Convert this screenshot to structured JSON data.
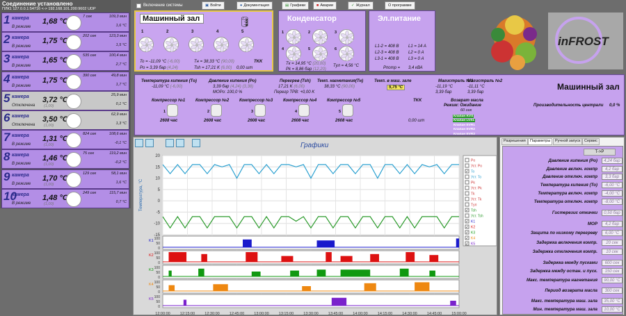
{
  "status": {
    "line1": "Соединение установлено",
    "line2": "ПЛК1 127.0.0.1:54716 <-> 192.168.101.200:9602 UDP"
  },
  "toolbar": {
    "enable_system": "Включение системы",
    "login": "Войти",
    "docs": "Документация",
    "charts": "Графики",
    "alarms": "Аварии",
    "journal": "Журнал",
    "about": "О программе"
  },
  "chambers": [
    {
      "num": "1",
      "label": "камера",
      "mode": "В режиме",
      "temp": "1,68 °C",
      "time": "7 сек",
      "v1": "109,3 мин",
      "v2": "1,6 °C",
      "off": false
    },
    {
      "num": "2",
      "label": "камера",
      "mode": "В режиме",
      "temp": "1,75 °C",
      "time": "202 сек",
      "v1": "123,3 мин",
      "v2": "1,5 °C",
      "off": false
    },
    {
      "num": "3",
      "label": "камера",
      "mode": "В режиме",
      "temp": "1,65 °C",
      "time": "535 сек",
      "v1": "100,4 мин",
      "v2": "2,7 °C",
      "off": false
    },
    {
      "num": "4",
      "label": "камера",
      "mode": "В режиме",
      "temp": "1,75 °C",
      "time": "390 сек",
      "v1": "49,8 мин",
      "v2": "1,7 °C",
      "off": false
    },
    {
      "num": "5",
      "label": "камера",
      "mode": "Отключена",
      "temp": "3,72 °C",
      "sub": "(1,00)",
      "time": "",
      "v1": "25,9 мин",
      "v2": "0,1 °C",
      "off": true
    },
    {
      "num": "6",
      "label": "камера",
      "mode": "Отключена",
      "temp": "3,50 °C",
      "sub": "(1,00)",
      "time": "",
      "v1": "62,9 мин",
      "v2": "1,3 °C",
      "off": true
    },
    {
      "num": "7",
      "label": "камера",
      "mode": "В режиме",
      "temp": "1,31 °C",
      "sub": "(1,00)",
      "time": "824 сек",
      "v1": "108,6 мин",
      "v2": "-0,1 °C",
      "off": false
    },
    {
      "num": "8",
      "label": "камера",
      "mode": "В режиме",
      "temp": "1,46 °C",
      "sub": "(1,00)",
      "time": "75 сек",
      "v1": "119,2 мин",
      "v2": "-0,2 °C",
      "off": false
    },
    {
      "num": "9",
      "label": "камера",
      "mode": "В режиме",
      "temp": "1,70 °C",
      "sub": "(1,00)",
      "time": "129 сек",
      "v1": "58,1 мин",
      "v2": "1,6 °C",
      "off": false
    },
    {
      "num": "10",
      "label": "камера",
      "mode": "В режиме",
      "temp": "1,48 °C",
      "sub": "(1,00)",
      "time": "249 сек",
      "v1": "115,7 мин",
      "v2": "0,7 °C",
      "off": false
    }
  ],
  "machine_room": {
    "title": "Машинный зал",
    "fans": [
      "1",
      "2",
      "3",
      "4",
      "5"
    ],
    "to": "To = -11,09 °C",
    "to_set": "(-6,00)",
    "po": "Po = 3,39 бар",
    "po_set": "(4,24)",
    "tn": "Tн = 38,33 °C",
    "tn_set": "(90,00)",
    "tsh": "Tsh = 17,21 K",
    "tsh_set": "(6,00)",
    "tkk_label": "TKK",
    "tkk": "0,00 шт"
  },
  "condenser": {
    "title": "Конденсатор",
    "fans": [
      "1",
      "2",
      "3",
      "4",
      "5",
      "6"
    ],
    "tk": "Tк = 14,95 °C",
    "tk_set": "(20,00)",
    "pk": "Pk = 8,86 бар",
    "pk_set": "(12,20)",
    "tul": "Tул = 4,56 °C"
  },
  "power": {
    "title": "Эл.питание",
    "l12": "L1-2 = 408 В",
    "l23": "L2-3 = 408 В",
    "l31": "L3-1 = 408 В",
    "i1": "L1 = 14 А",
    "i2": "L2 = 0 А",
    "i3": "L3 = 0 А",
    "p_label": "Pпотр =",
    "p": "3,4 кВА"
  },
  "logo": "inFROST",
  "mid": {
    "header": "Машинный зал",
    "boiling_t_label": "Температура кипения (Tо)",
    "boiling_t": "-11,09 °C",
    "boiling_t_set": "(-6,00)",
    "boiling_p_label": "Давление кипения (Pо)",
    "boiling_p": "3,39 бар",
    "boiling_p_set": "(4,24)",
    "boiling_p_set2": "(3,38)",
    "mor_label": "МОРо:",
    "mor": "100,0 %",
    "superheat_label": "Перегрев (Tsh)",
    "superheat": "17,21 K",
    "superheat_set": "(6,00)",
    "trv_label": "Перегр ТРВ:",
    "trv": "+0,00 K",
    "discharge_label": "Темп. нагнетания(Tн)",
    "discharge": "38,33 °C",
    "discharge_set": "(90,00)",
    "room_t_label": "Темп. в маш. зале",
    "room_t": "5,75 °C",
    "main1_label": "Магистраль №1",
    "main1_t": "-11,19 °C",
    "main1_p": "3,39 бар",
    "main2_label": "Магистраль №2",
    "main2_t": "-11,11 °C",
    "main2_p": "3,39 бар",
    "compressors": [
      {
        "label": "Компрессор №1",
        "num": "1",
        "hours": "2608 час"
      },
      {
        "label": "Компрессор №2",
        "num": "2",
        "hours": "2608 час"
      },
      {
        "label": "Компрессор №3",
        "num": "3",
        "hours": "2608 час"
      },
      {
        "label": "Компрессор №4",
        "num": "4",
        "hours": "2608 час"
      },
      {
        "label": "Компрессор №5",
        "num": "5",
        "hours": "2608 час"
      }
    ],
    "tkk_label": "TKK",
    "tkk": "0,00 шт",
    "oil_label": "Возврат масла",
    "oil_mode": "Режим: Ожидание",
    "oil_time": "60 сек",
    "valves": [
      "Клапан KVS",
      "Клапан LVS1",
      "Клапан EVR1",
      "Клапан EVR2",
      "Клапан EVR3"
    ],
    "perf_label": "Производительность централи",
    "perf": "0,0 %"
  },
  "chart_panel": {
    "title": "Графики",
    "y_label": "Температура, °C",
    "y_ticks": [
      "20",
      "15",
      "10",
      "5",
      "0",
      "-5",
      "-10",
      "-15"
    ],
    "k_ticks": [
      "100",
      "50",
      "0"
    ],
    "k_labels": [
      "K1",
      "K2",
      "K3",
      "K4",
      "K5"
    ],
    "x_ticks": [
      "12:00:00",
      "12:15:00",
      "12:30:00",
      "12:45:00",
      "13:00:00",
      "13:15:00",
      "13:30:00",
      "13:45:00",
      "14:00:00",
      "14:15:00",
      "14:30:00",
      "14:45:00",
      "15:00:00"
    ],
    "x_date": "14.02.2022",
    "legend": [
      {
        "name": "Po",
        "checked": false,
        "color": "#cc3333"
      },
      {
        "name": "Уст. Po",
        "checked": false,
        "color": "#cc3333"
      },
      {
        "name": "To",
        "checked": true,
        "color": "#2aa0d0"
      },
      {
        "name": "Уст. To",
        "checked": false,
        "color": "#2aa0d0"
      },
      {
        "name": "Pk",
        "checked": false,
        "color": "#cc3333"
      },
      {
        "name": "Уст. Pk",
        "checked": false,
        "color": "#cc3333"
      },
      {
        "name": "Tk",
        "checked": false,
        "color": "#cc3333"
      },
      {
        "name": "Уст. Tk",
        "checked": false,
        "color": "#cc3333"
      },
      {
        "name": "Tул",
        "checked": false,
        "color": "#cc3333"
      },
      {
        "name": "Tsh",
        "checked": true,
        "color": "#2a9a2a"
      },
      {
        "name": "Уст. Tsh",
        "checked": false,
        "color": "#2a9a2a"
      },
      {
        "name": "K1",
        "checked": true,
        "color": "#1a1acc"
      },
      {
        "name": "K2",
        "checked": true,
        "color": "#dd1111"
      },
      {
        "name": "K3",
        "checked": true,
        "color": "#119911"
      },
      {
        "name": "K4",
        "checked": true,
        "color": "#ee8811"
      },
      {
        "name": "K5",
        "checked": true,
        "color": "#7a22cc"
      }
    ]
  },
  "chart_data": {
    "type": "line",
    "x_range": [
      "12:00:00",
      "15:00:00"
    ],
    "ylim": [
      -15,
      20
    ],
    "ylabel": "Температура, °C",
    "series": [
      {
        "name": "To",
        "color": "#2aa0d0",
        "values": [
          16,
          12,
          16,
          12,
          16,
          16,
          12,
          16,
          15,
          16,
          10,
          16,
          16,
          12,
          16,
          12,
          16,
          16,
          15,
          16,
          10,
          16,
          16,
          12,
          16,
          16,
          12,
          16,
          16,
          10,
          16,
          16,
          12,
          16,
          12,
          16,
          15,
          16,
          12,
          16,
          16
        ]
      },
      {
        "name": "Tsh",
        "color": "#2a9a2a",
        "values": [
          -7,
          -12,
          -7,
          -12,
          -7,
          -7,
          -12,
          -7,
          -7,
          -7,
          -12,
          -7,
          -7,
          -12,
          -7,
          -12,
          -7,
          -7,
          -9,
          -7,
          -12,
          -7,
          -7,
          -12,
          -7,
          -7,
          -12,
          -7,
          -7,
          -12,
          -7,
          -7,
          -12,
          -7,
          -12,
          -7,
          -7,
          -7,
          -12,
          -7,
          -7
        ]
      }
    ],
    "compressors": [
      {
        "name": "K1",
        "color": "#1a1acc",
        "bursts": [
          [
            0.27,
            0.3,
            80
          ],
          [
            0.52,
            0.58,
            70
          ],
          [
            0.99,
            1.0,
            90
          ]
        ]
      },
      {
        "name": "K2",
        "color": "#dd1111",
        "bursts": [
          [
            0.02,
            0.08,
            100
          ],
          [
            0.13,
            0.15,
            80
          ],
          [
            0.28,
            0.32,
            100
          ],
          [
            0.4,
            0.44,
            60
          ],
          [
            0.55,
            0.57,
            100
          ],
          [
            0.6,
            0.64,
            60
          ],
          [
            0.7,
            0.73,
            80
          ],
          [
            0.82,
            0.85,
            100
          ],
          [
            0.9,
            0.93,
            70
          ]
        ]
      },
      {
        "name": "K3",
        "color": "#119911",
        "bursts": [
          [
            0.02,
            0.03,
            60
          ],
          [
            0.12,
            0.14,
            80
          ],
          [
            0.3,
            0.33,
            50
          ],
          [
            0.43,
            0.46,
            60
          ],
          [
            0.52,
            0.55,
            70
          ],
          [
            0.6,
            0.7,
            70
          ],
          [
            0.8,
            0.83,
            80
          ],
          [
            0.9,
            0.92,
            60
          ]
        ]
      },
      {
        "name": "K4",
        "color": "#ee8811",
        "bursts": [
          [
            0.02,
            0.04,
            60
          ],
          [
            0.17,
            0.22,
            70
          ],
          [
            0.47,
            0.5,
            50
          ],
          [
            0.68,
            0.72,
            80
          ],
          [
            0.85,
            0.9,
            90
          ]
        ]
      },
      {
        "name": "K5",
        "color": "#7a22cc",
        "bursts": [
          [
            0.07,
            0.08,
            60
          ],
          [
            0.57,
            0.62,
            80
          ],
          [
            0.97,
            0.99,
            50
          ]
        ]
      }
    ]
  },
  "right_panel": {
    "tabs": [
      "Разрешения",
      "Параметры",
      "Ручной запуск",
      "Сервис"
    ],
    "badge": "T->P",
    "params": [
      {
        "label": "Давление кипения (Po)",
        "value": "4,24 бар"
      },
      {
        "label": "Давление включ. компр",
        "value": "4,2 бар"
      },
      {
        "label": "Давление отключ. компр",
        "value": "3,3 бар"
      },
      {
        "label": "Температура кипения (To)",
        "value": "-6,00 °C"
      },
      {
        "label": "Температура включ. компр",
        "value": "-4,00 °C"
      },
      {
        "label": "Температура отключ. компр",
        "value": "-8,00 °C"
      },
      {
        "label": "Гистерезис откачки",
        "value": "0,50 бар"
      },
      {
        "label": "МОР",
        "value": "4,2 бар"
      },
      {
        "label": "Защита по низкому перегреву",
        "value": "6,00 °C"
      },
      {
        "label": "Задержка включения компр.",
        "value": "20 сек"
      },
      {
        "label": "Задержка отключения компр.",
        "value": "10 сек"
      },
      {
        "label": "Задержка между пусками",
        "value": "600 сек"
      },
      {
        "label": "Задержка между остан. и пуск.",
        "value": "150 сек"
      },
      {
        "label": "Макс. температура нагнетания",
        "value": "90,00 °C"
      },
      {
        "label": "Период возврата масла",
        "value": "300 сек"
      },
      {
        "label": "Макс. температура маш. зала",
        "value": "35,00 °C"
      },
      {
        "label": "Мин. температура маш. зала",
        "value": "10,00 °C"
      }
    ]
  }
}
